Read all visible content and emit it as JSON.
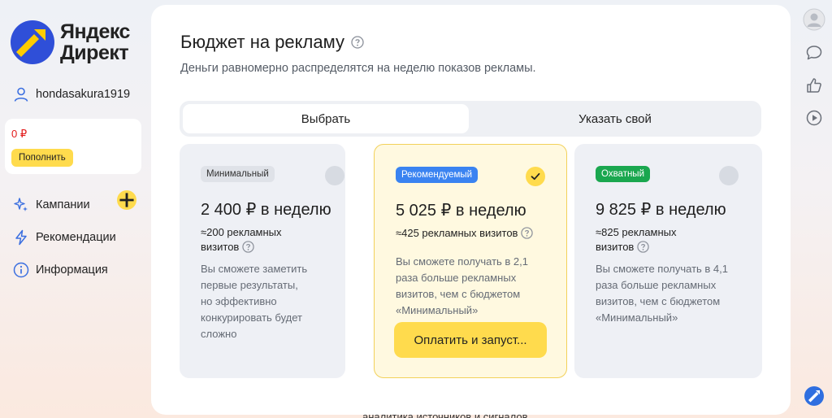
{
  "brand": {
    "line1": "Яндекс",
    "line2": "Директ",
    "colors": {
      "accent": "#ffdb4d",
      "logo_blue": "#2f4fd8",
      "logo_yellow": "#ffcc00"
    }
  },
  "sidebar": {
    "username": "hondasakura1919",
    "balance": "0 ₽",
    "topup_label": "Пополнить",
    "nav": [
      {
        "label": "Кампании",
        "icon": "sparkle-icon"
      },
      {
        "label": "Рекомендации",
        "icon": "lightning-icon"
      },
      {
        "label": "Информация",
        "icon": "info-icon"
      }
    ]
  },
  "modal": {
    "title": "Бюджет на рекламу",
    "subtitle": "Деньги равномерно распределятся на неделю показов рекламы.",
    "tabs": [
      {
        "label": "Выбрать",
        "active": true
      },
      {
        "label": "Указать свой",
        "active": false
      }
    ],
    "cards": [
      {
        "badge": "Минимальный",
        "price": "2 400 ₽ в неделю",
        "visits_line1": "≈200 рекламных",
        "visits_line2": "визитов",
        "desc": [
          "Вы сможете заметить",
          "первые результаты,",
          "но эффективно",
          "конкурировать будет",
          "сложно"
        ],
        "selected": false
      },
      {
        "badge": "Рекомендуемый",
        "price": "5 025 ₽ в неделю",
        "visits_line1": "≈425 рекламных визитов",
        "desc": [
          "Вы сможете получать в 2,1",
          "раза больше рекламных",
          "визитов, чем с бюджетом",
          "«Минимальный»"
        ],
        "button": "Оплатить и запуст...",
        "selected": true
      },
      {
        "badge": "Охватный",
        "price": "9 825 ₽ в неделю",
        "visits_line1": "≈825 рекламных",
        "visits_line2": "визитов",
        "desc": [
          "Вы сможете получать в 4,1",
          "раза больше рекламных",
          "визитов, чем с бюджетом",
          "«Минимальный»"
        ],
        "selected": false
      }
    ]
  },
  "bottom_text": "аналитика источников и сигналов"
}
